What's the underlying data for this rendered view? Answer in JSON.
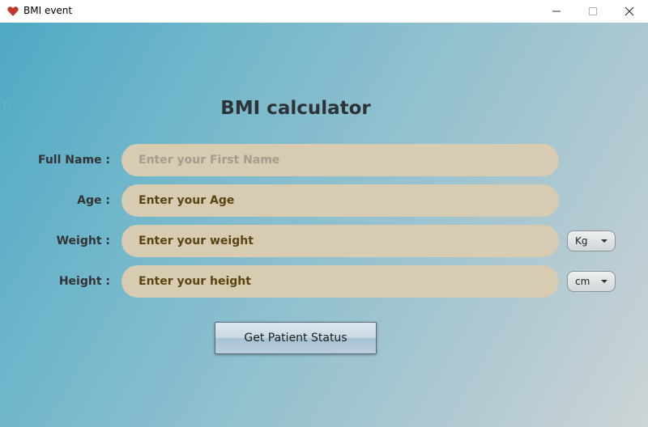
{
  "window": {
    "title": "BMI event",
    "icon": "heart-icon",
    "accent": "#c0392b"
  },
  "background_mark": ");",
  "form": {
    "heading": "BMI calculator",
    "fields": [
      {
        "label": "Full Name :",
        "placeholder": "Enter your First Name",
        "value": ""
      },
      {
        "label": "Age :",
        "placeholder": "Enter your Age",
        "value": ""
      },
      {
        "label": "Weight :",
        "placeholder": "Enter your weight",
        "value": "",
        "unit_selected": "Kg"
      },
      {
        "label": "Height :",
        "placeholder": "Enter your height",
        "value": "",
        "unit_selected": "cm"
      }
    ],
    "submit_label": "Get Patient Status"
  },
  "colors": {
    "field_bg": "#d7ccb1",
    "field_text": "#5a4512",
    "heading": "#2e3335"
  }
}
